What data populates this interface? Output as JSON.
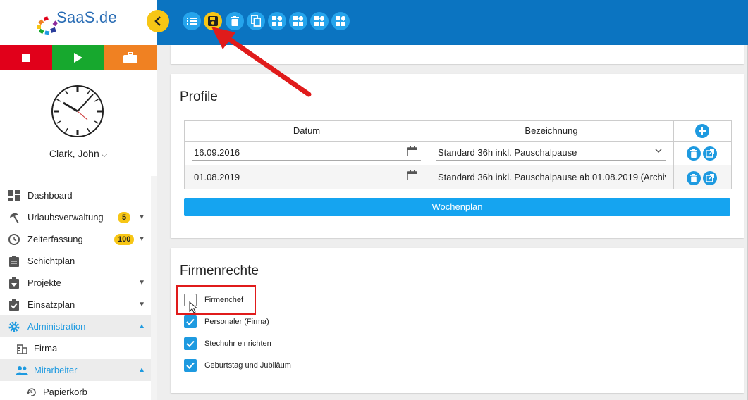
{
  "brand": {
    "logo_text": "SaaS.de"
  },
  "user": {
    "name": "Clark, John"
  },
  "nav": {
    "items": [
      {
        "label": "Dashboard"
      },
      {
        "label": "Urlaubsverwaltung",
        "badge": "5"
      },
      {
        "label": "Zeiterfassung",
        "badge": "100"
      },
      {
        "label": "Schichtplan"
      },
      {
        "label": "Projekte"
      },
      {
        "label": "Einsatzplan"
      },
      {
        "label": "Administration"
      },
      {
        "label": "Firma"
      },
      {
        "label": "Mitarbeiter"
      },
      {
        "label": "Papierkorb"
      }
    ]
  },
  "profile": {
    "title": "Profile",
    "col_datum": "Datum",
    "col_bezeichnung": "Bezeichnung",
    "rows": [
      {
        "datum": "16.09.2016",
        "bezeichnung": "Standard 36h inkl. Pauschalpause"
      },
      {
        "datum": "01.08.2019",
        "bezeichnung": "Standard 36h inkl. Pauschalpause ab 01.08.2019 (Archiv"
      }
    ],
    "wochenplan_label": "Wochenplan"
  },
  "rights": {
    "title": "Firmenrechte",
    "items": [
      {
        "label": "Firmenchef",
        "checked": false
      },
      {
        "label": "Personaler (Firma)",
        "checked": true
      },
      {
        "label": "Stechuhr einrichten",
        "checked": true
      },
      {
        "label": "Geburtstag und Jubiläum",
        "checked": true
      }
    ]
  },
  "colors": {
    "header": "#0b74c1",
    "accent": "#1e9ae0",
    "save_button": "#f7c615",
    "highlight": "#e01b1b"
  }
}
